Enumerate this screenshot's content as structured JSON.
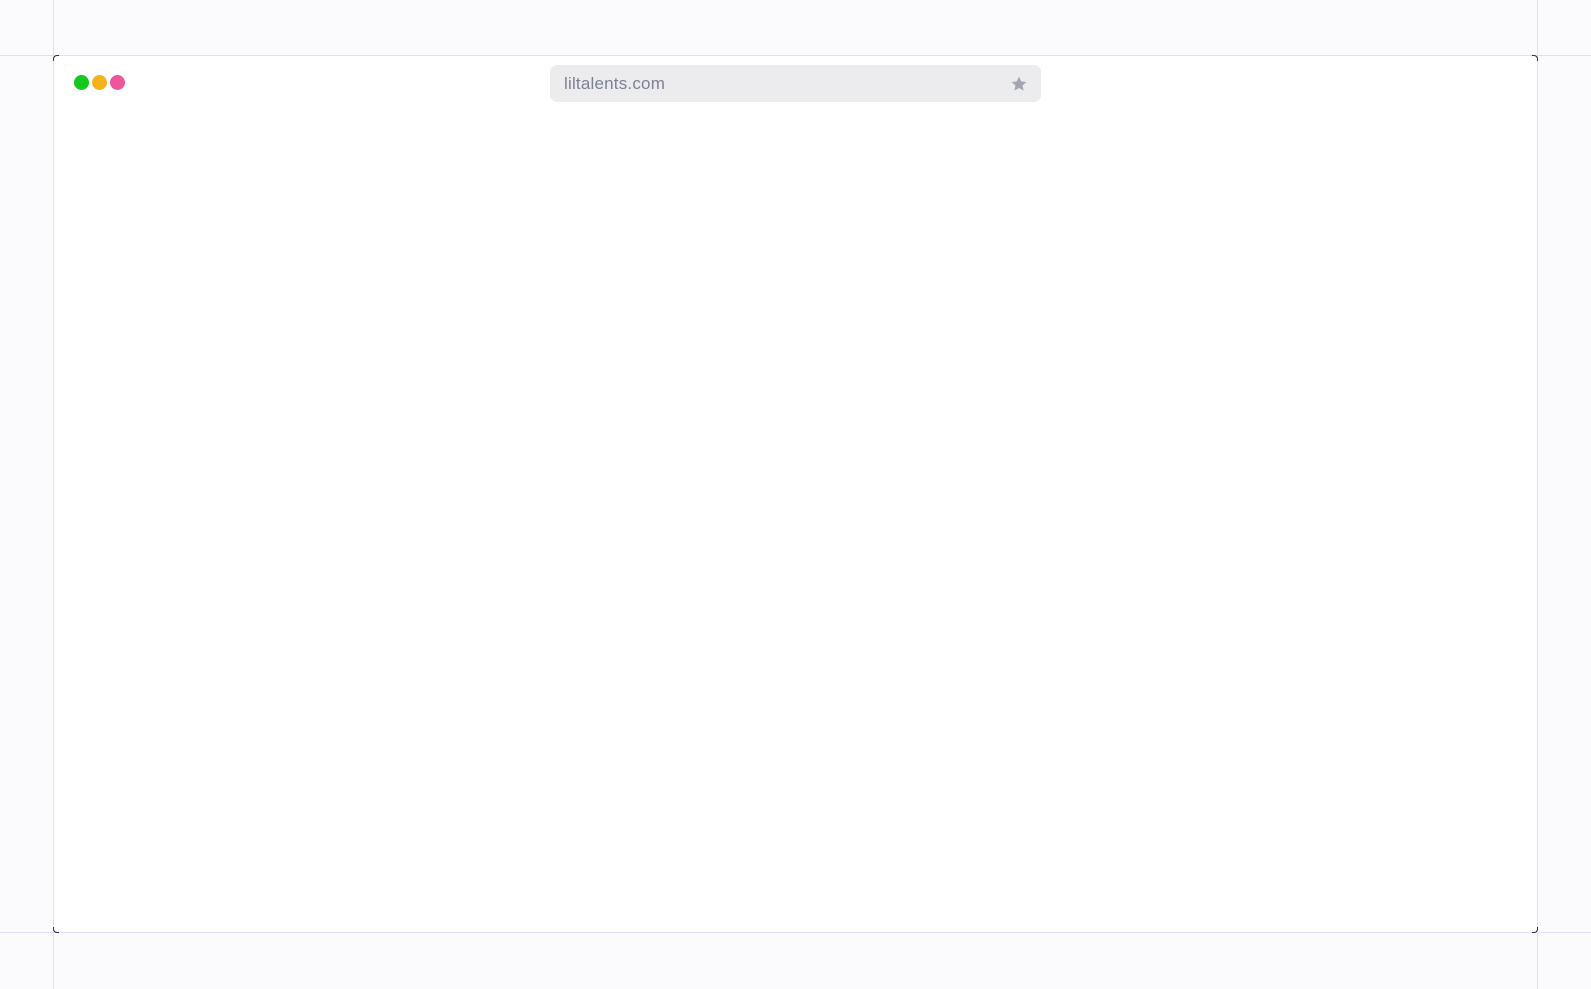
{
  "window": {
    "traffic_lights": [
      {
        "name": "green",
        "color": "#14c81d"
      },
      {
        "name": "yellow",
        "color": "#f5b31b"
      },
      {
        "name": "pink",
        "color": "#f0559a"
      }
    ]
  },
  "address_bar": {
    "url": "liltalents.com",
    "bookmark_icon": "star-icon",
    "bookmark_icon_color": "#a3a6b2"
  },
  "colors": {
    "guide_lines": "#dde1f3",
    "page_background": "#fbfbfd",
    "window_background": "#ffffff"
  }
}
